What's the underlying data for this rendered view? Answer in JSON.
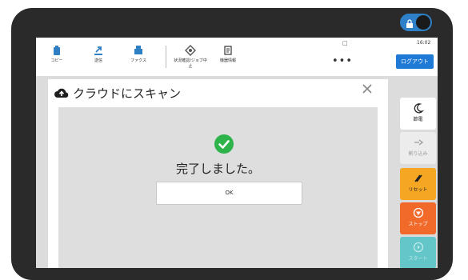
{
  "header": {
    "status_indicator": "□",
    "time": "16:02",
    "more": "•••",
    "logout_label": "ログアウト",
    "items": [
      {
        "label": "コピー",
        "icon": "copy-icon"
      },
      {
        "label": "送信",
        "icon": "send-icon"
      },
      {
        "label": "ファクス",
        "icon": "fax-icon"
      },
      {
        "label": "状況確認/ジョブ中止",
        "icon": "status-check-icon"
      },
      {
        "label": "機器情報",
        "icon": "device-info-icon"
      }
    ]
  },
  "dialog": {
    "title": "クラウドにスキャン",
    "message": "完了しました。",
    "ok_label": "OK"
  },
  "side_buttons": {
    "sleep": "節電",
    "interrupt": "割り込み",
    "reset": "リセット",
    "stop": "ストップ",
    "start": "スタート"
  },
  "colors": {
    "accent": "#1e7ad4",
    "success": "#2db34a",
    "reset": "#f5a623",
    "stop": "#f26a2a",
    "start": "#64c6c8"
  }
}
